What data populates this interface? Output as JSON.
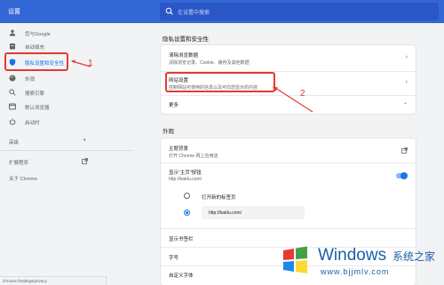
{
  "header": {
    "title": "设置",
    "search_placeholder": "在设置中搜索"
  },
  "sidebar": {
    "items": [
      {
        "label": "您与Google",
        "icon": "person-icon"
      },
      {
        "label": "自动填充",
        "icon": "clipboard-icon"
      },
      {
        "label": "隐私设置和安全性",
        "icon": "shield-icon",
        "active": true
      },
      {
        "label": "外观",
        "icon": "palette-icon"
      },
      {
        "label": "搜索引擎",
        "icon": "search-icon"
      },
      {
        "label": "默认浏览器",
        "icon": "browser-icon"
      },
      {
        "label": "启动时",
        "icon": "power-icon"
      }
    ],
    "advanced_label": "高级",
    "extensions_label": "扩展程序",
    "about_label": "关于 Chrome"
  },
  "privacy": {
    "heading": "隐私设置和安全性",
    "rows": [
      {
        "title": "清除浏览数据",
        "subtitle": "清除浏览记录、Cookie、缓存及其他数据"
      },
      {
        "title": "网站设置",
        "subtitle": "控制网站可使用的信息以及可向您显示的内容"
      },
      {
        "title": "更多"
      }
    ]
  },
  "appearance": {
    "heading": "外观",
    "theme_title": "主题背景",
    "theme_subtitle": "打开 Chrome 网上应用店",
    "home_button_title": "显示“主页”按钮",
    "home_button_subtitle": "http://baidu.com/",
    "home_button_enabled": true,
    "radio_new_tab": "打开新的标签页",
    "radio_custom_url": "http://baidu.com/",
    "radio_selected": "custom_url",
    "bookmarks_bar": "显示书签栏",
    "font_size": "字号",
    "custom_fonts": "自定义字体"
  },
  "annotations": {
    "marker1": "1",
    "marker2": "2",
    "color": "#e53935"
  },
  "status_bar": "chrome://settings/privacy",
  "watermark": {
    "brand": "Windows",
    "cn": "系统之家",
    "url": "www.bjjmlv.com"
  },
  "colors": {
    "header": "#3367d6",
    "accent": "#1a73e8",
    "background": "#f1f3f4"
  }
}
